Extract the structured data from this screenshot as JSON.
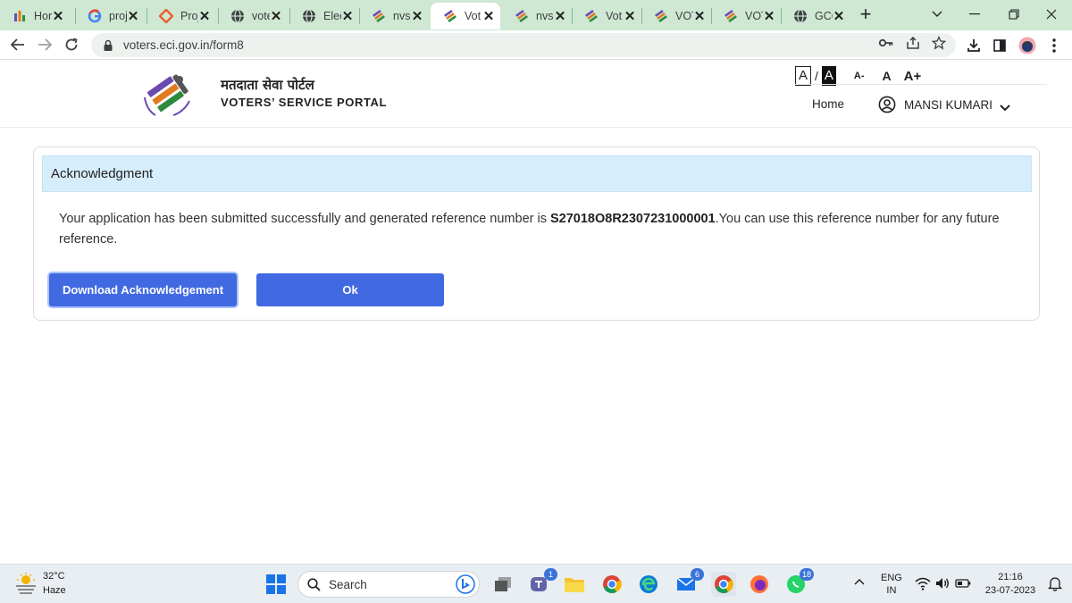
{
  "browser": {
    "tabs": [
      {
        "title": "Hor",
        "icon": "site-icon"
      },
      {
        "title": "proj",
        "icon": "google-icon"
      },
      {
        "title": "Proj",
        "icon": "diamond-icon"
      },
      {
        "title": "vote",
        "icon": "globe-icon"
      },
      {
        "title": "Elec",
        "icon": "globe-icon"
      },
      {
        "title": "nvsi",
        "icon": "eci-icon"
      },
      {
        "title": "Vot",
        "icon": "eci-icon",
        "active": true
      },
      {
        "title": "nvsi",
        "icon": "eci-icon"
      },
      {
        "title": "Vot",
        "icon": "eci-icon"
      },
      {
        "title": "VOT",
        "icon": "eci-icon"
      },
      {
        "title": "VOT",
        "icon": "eci-icon"
      },
      {
        "title": "GCC",
        "icon": "globe-icon"
      }
    ],
    "close_glyph": "✕",
    "new_tab_glyph": "+",
    "url": "voters.eci.gov.in/form8"
  },
  "site": {
    "portal_name_hindi": "मतदाता सेवा पोर्टल",
    "portal_name_english": "VOTERS’ SERVICE PORTAL",
    "a11y": {
      "contrast_light": "A",
      "separator": "/",
      "contrast_dark": "A",
      "font_small": "A-",
      "font_normal": "A",
      "font_large": "A+"
    },
    "nav": {
      "home": "Home",
      "user_name": "MANSI KUMARI"
    }
  },
  "ack": {
    "heading": "Acknowledgment",
    "message_prefix": "Your application has been submitted successfully and generated reference number is ",
    "reference_number": "S27018O8R2307231000001",
    "message_suffix": ".You can use this reference number for any future reference.",
    "download_label": "Download Acknowledgement",
    "ok_label": "Ok"
  },
  "taskbar": {
    "temperature": "32°C",
    "condition": "Haze",
    "search_placeholder": "Search",
    "badges": {
      "teams": "1",
      "mail": "6",
      "whatsapp": "18"
    },
    "lang_line1": "ENG",
    "lang_line2": "IN",
    "time": "21:16",
    "date": "23-07-2023"
  },
  "colors": {
    "tabstrip_bg": "#cfe8d3",
    "primary_button": "#4169e1",
    "ack_header_bg": "#d6edfb"
  }
}
